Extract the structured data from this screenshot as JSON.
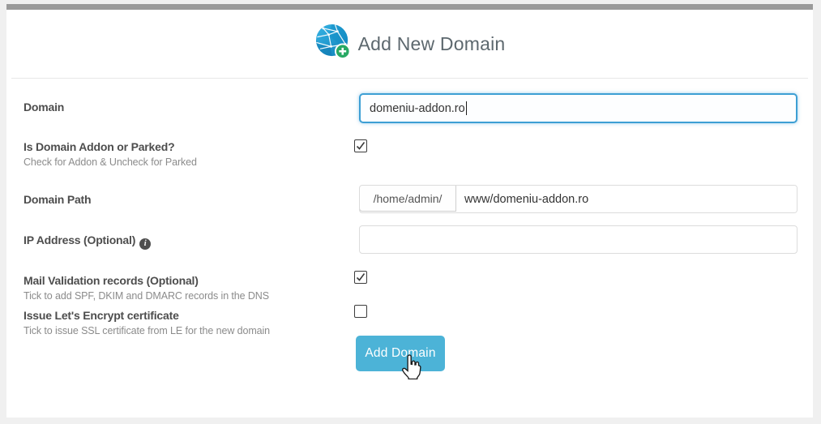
{
  "header": {
    "title": "Add New Domain"
  },
  "fields": {
    "domain": {
      "label": "Domain",
      "value": "domeniu-addon.ro"
    },
    "addon_parked": {
      "label": "Is Domain Addon or Parked?",
      "hint": "Check for Addon & Uncheck for Parked",
      "checked": true
    },
    "domain_path": {
      "label": "Domain Path",
      "prefix": "/home/admin/",
      "value": "www/domeniu-addon.ro"
    },
    "ip_address": {
      "label": "IP Address (Optional)",
      "value": ""
    },
    "mail_validation": {
      "label": "Mail Validation records (Optional)",
      "hint": "Tick to add SPF, DKIM and DMARC records in the DNS",
      "checked": true
    },
    "lets_encrypt": {
      "label": "Issue Let's Encrypt certificate",
      "hint": "Tick to issue SSL certificate from LE for the new domain",
      "checked": false
    }
  },
  "actions": {
    "add_domain_label": "Add Domain"
  },
  "colors": {
    "accent_button": "#4cb3d7",
    "focus_border": "#3d9fd4",
    "topbar": "#9a9a9a",
    "page_background": "#f0f0f0"
  }
}
